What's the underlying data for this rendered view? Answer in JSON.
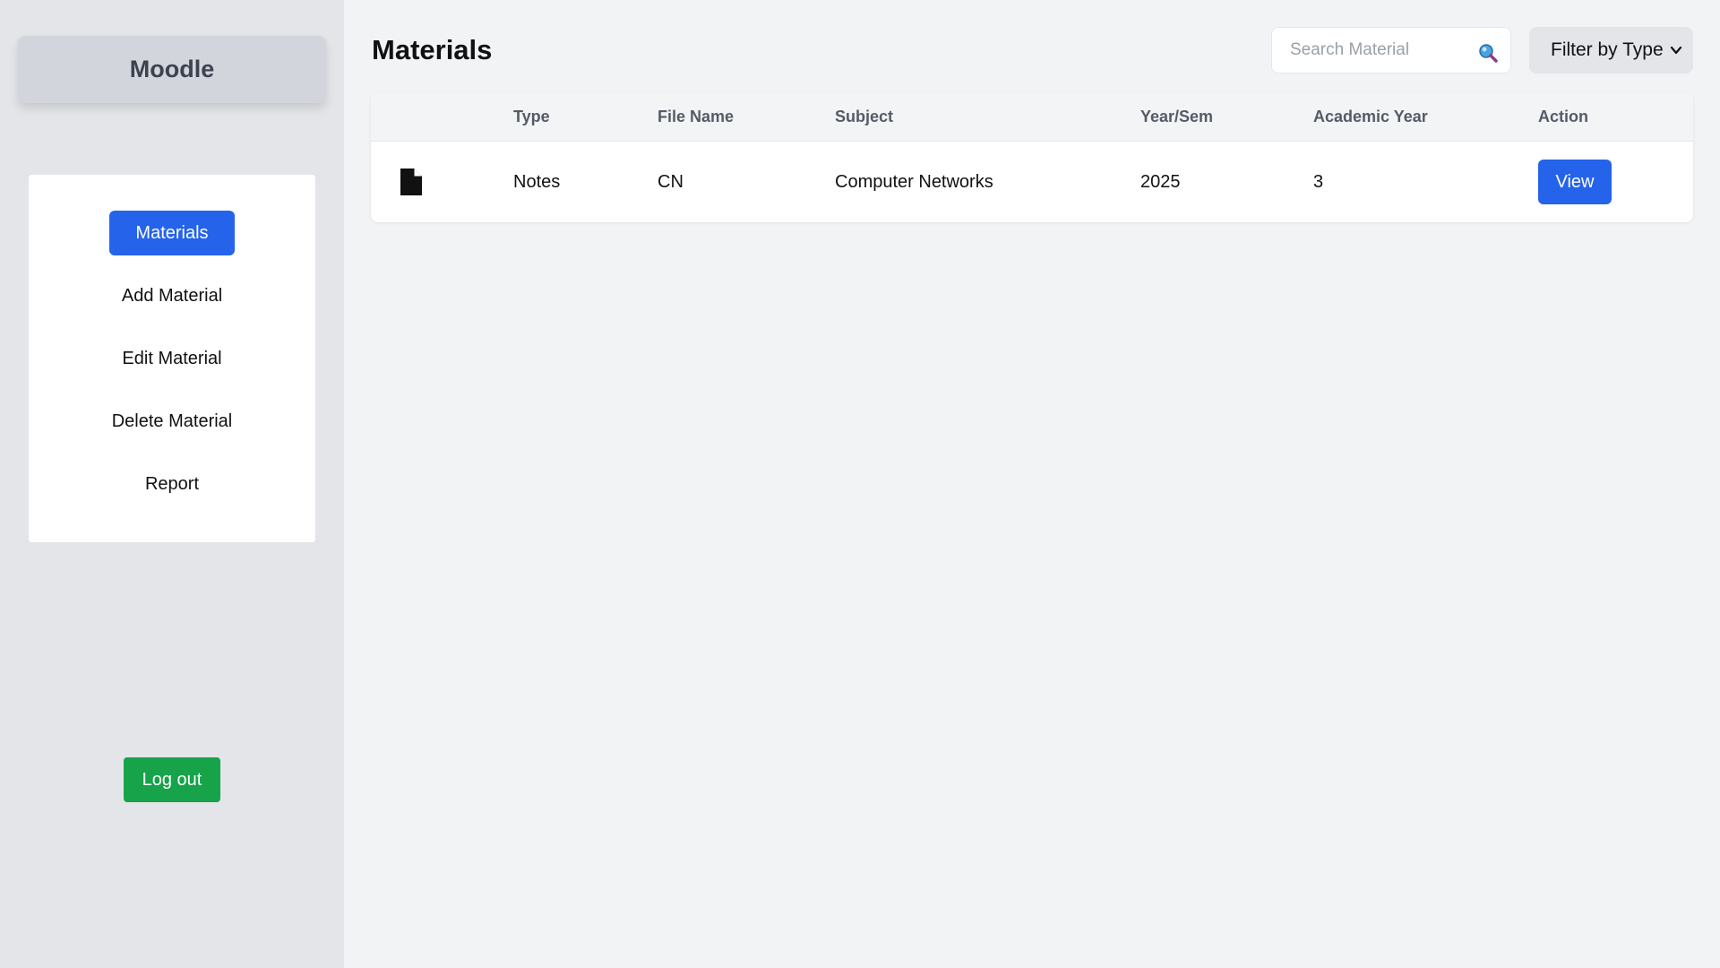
{
  "app": {
    "brand": "Moodle"
  },
  "sidebar": {
    "items": [
      {
        "label": "Materials",
        "active": true
      },
      {
        "label": "Add Material",
        "active": false
      },
      {
        "label": "Edit Material",
        "active": false
      },
      {
        "label": "Delete Material",
        "active": false
      },
      {
        "label": "Report",
        "active": false
      }
    ],
    "logout_label": "Log out"
  },
  "main": {
    "title": "Materials",
    "search": {
      "placeholder": "Search Material",
      "value": "",
      "icon": "search-icon"
    },
    "filter": {
      "selected": "Filter by Type",
      "icon": "chevron-down-icon"
    },
    "table": {
      "headers": [
        "",
        "Type",
        "File Name",
        "Subject",
        "Year/Sem",
        "Academic Year",
        "Action"
      ],
      "rows": [
        {
          "icon": "file-icon",
          "type": "Notes",
          "file_name": "CN",
          "subject": "Computer Networks",
          "year_sem": "2025",
          "academic_year": "3",
          "action_label": "View"
        }
      ]
    }
  },
  "colors": {
    "primary": "#2563eb",
    "success": "#16a34a",
    "sidebar_bg": "#e4e5e9",
    "page_bg": "#f2f3f5"
  }
}
